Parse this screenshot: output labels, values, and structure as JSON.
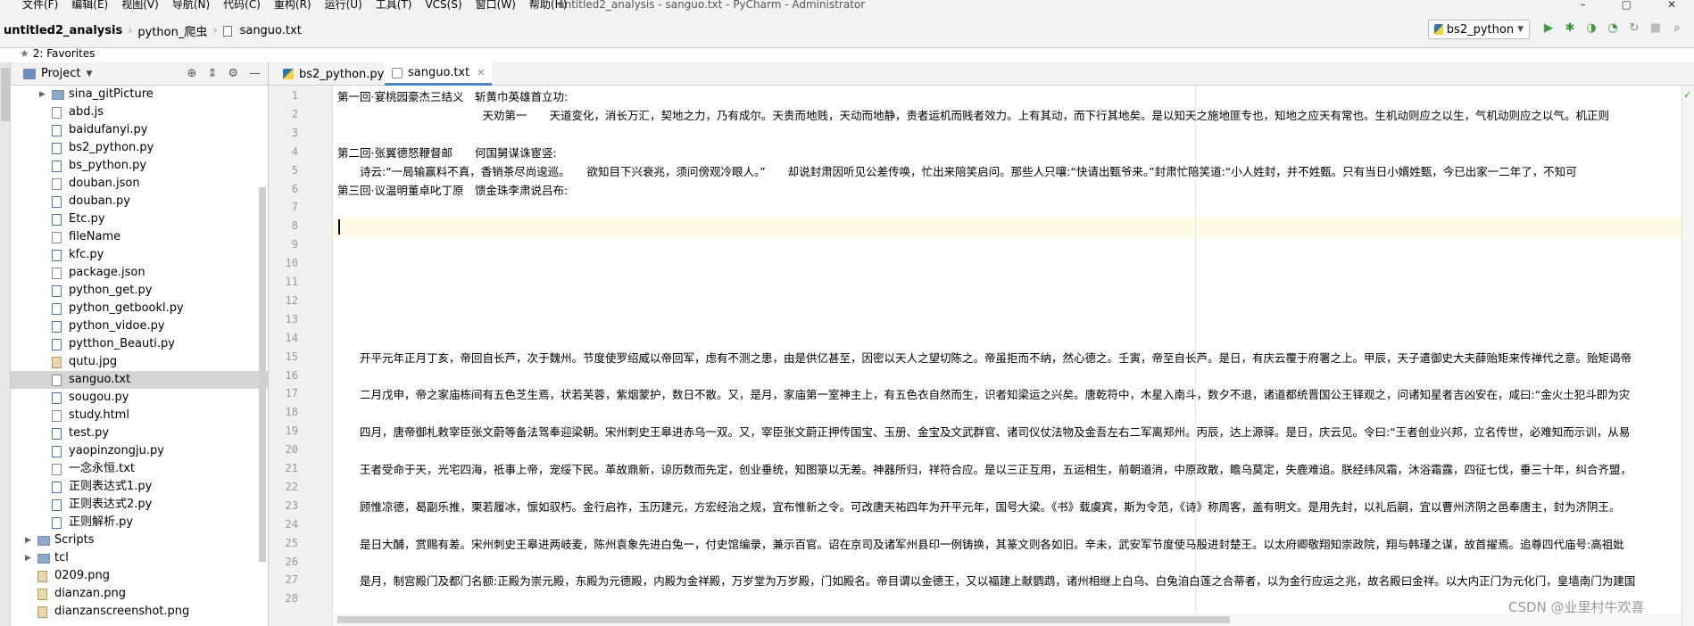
{
  "menubar": {
    "items": [
      "文件(F)",
      "编辑(E)",
      "视图(V)",
      "导航(N)",
      "代码(C)",
      "重构(R)",
      "运行(U)",
      "工具(T)",
      "VCS(S)",
      "窗口(W)",
      "帮助(H)"
    ],
    "window_title": "untitled2_analysis - sanguo.txt - PyCharm - Administrator"
  },
  "navbar": {
    "project": "untitled2_analysis",
    "folder": "python_爬虫",
    "file": "sanguo.txt",
    "run_config": "bs2_python"
  },
  "favorites": {
    "label": "2: Favorites"
  },
  "project_panel": {
    "title": "Project",
    "items": [
      {
        "name": "sina_gitPicture",
        "kind": "folder",
        "expand": true
      },
      {
        "name": "abd.js",
        "kind": "file"
      },
      {
        "name": "baidufanyi.py",
        "kind": "py"
      },
      {
        "name": "bs2_python.py",
        "kind": "py"
      },
      {
        "name": "bs_python.py",
        "kind": "py"
      },
      {
        "name": "douban.json",
        "kind": "file"
      },
      {
        "name": "douban.py",
        "kind": "py"
      },
      {
        "name": "Etc.py",
        "kind": "py"
      },
      {
        "name": "fileName",
        "kind": "file"
      },
      {
        "name": "kfc.py",
        "kind": "py"
      },
      {
        "name": "package.json",
        "kind": "file"
      },
      {
        "name": "python_get.py",
        "kind": "py"
      },
      {
        "name": "python_getbookl.py",
        "kind": "py"
      },
      {
        "name": "python_vidoe.py",
        "kind": "py"
      },
      {
        "name": "pytthon_Beauti.py",
        "kind": "py"
      },
      {
        "name": "qutu.jpg",
        "kind": "img"
      },
      {
        "name": "sanguo.txt",
        "kind": "file",
        "selected": true
      },
      {
        "name": "sougou.py",
        "kind": "py"
      },
      {
        "name": "study.html",
        "kind": "file"
      },
      {
        "name": "test.py",
        "kind": "py"
      },
      {
        "name": "yaopinzongju.py",
        "kind": "py"
      },
      {
        "name": "一念永恒.txt",
        "kind": "file"
      },
      {
        "name": "正则表达式1.py",
        "kind": "py"
      },
      {
        "name": "正则表达式2.py",
        "kind": "py"
      },
      {
        "name": "正则解析.py",
        "kind": "py"
      },
      {
        "name": "Scripts",
        "kind": "folder",
        "expand": true,
        "level": 0
      },
      {
        "name": "tcl",
        "kind": "folder",
        "expand": true,
        "level": 0
      },
      {
        "name": "0209.png",
        "kind": "img",
        "level": 0
      },
      {
        "name": "dianzan.png",
        "kind": "img",
        "level": 0
      },
      {
        "name": "dianzanscreenshot.png",
        "kind": "img",
        "level": 0
      }
    ]
  },
  "tabs": [
    {
      "label": "bs2_python.py",
      "active": false
    },
    {
      "label": "sanguo.txt",
      "active": true
    }
  ],
  "editor": {
    "line_numbers": [
      "1",
      "2",
      "3",
      "4",
      "5",
      "6",
      "7",
      "8",
      "9",
      "10",
      "11",
      "12",
      "13",
      "14",
      "15",
      "16",
      "17",
      "18",
      "19",
      "20",
      "21",
      "22",
      "23",
      "24",
      "25",
      "26",
      "27",
      "28"
    ],
    "lines": [
      "第一回·宴桃园豪杰三结义　斩黄巾英雄首立功:",
      "　　　　　　　　　　　　　天劝第一　　天道变化，消长万汇，契地之力，乃有成尔。天贵而地贱，天动而地静，贵者运机而贱者效力。上有其动，而下行其地矣。是以知天之施地匪专也，知地之应天有常也。生机动则应之以生，气机动则应之以气。机正则",
      "",
      "第二回·张翼德怒鞭督邮　　何国舅谋诛宦竖:",
      "　　诗云:“一局输赢料不真，香销茶尽尚逡巡。　　欲知目下兴衰兆，须问傍观冷眼人。”　　却说封肃因听见公差传唤，忙出来陪笑启问。那些人只嚷:“快请出甄爷来。”封肃忙陪笑道:“小人姓封，并不姓甄。只有当日小婿姓甄，今已出家一二年了，不知可",
      "第三回·议温明董卓叱丁原　馈金珠李肃说吕布:",
      "",
      "",
      "",
      "",
      "",
      "",
      "",
      "",
      "　　开平元年正月丁亥，帝回自长芦，次于魏州。节度使罗绍威以帝回军，虑有不测之患，由是供亿甚至，因密以天人之望切陈之。帝虽拒而不纳，然心德之。壬寅，帝至自长芦。是日，有庆云覆于府署之上。甲辰，天子遣御史大夫薛贻矩来传禅代之意。贻矩谒帝",
      "",
      "　　二月戊申，帝之家庙栋间有五色芝生焉，状若芙蓉，紫烟蒙护，数日不散。又，是月，家庙第一室神主上，有五色衣自然而生，识者知梁运之兴矣。唐乾符中，木星入南斗，数夕不退，诸道都统晋国公王铎观之，问诸知星者吉凶安在，咸曰:“金火土犯斗即为灾",
      "",
      "　　四月，唐帝御札敕宰臣张文蔚等备法驾奉迎梁朝。宋州刺史王皋进赤乌一双。又，宰臣张文蔚正押传国宝、玉册、金宝及文武群官、诸司仪仗法物及金吾左右二军离郑州。丙辰，达上源驿。是日，庆云见。令曰:“王者创业兴邦，立名传世，必难知而示训，从易",
      "",
      "　　王者受命于天，光宅四海，祗事上帝，宠绥下民。革故鼎新，谅历数而先定，创业垂统，知图箓以无差。神器所归，祥符合应。是以三正互用，五运相生，前朝道消，中原政散，瞻乌莫定，失鹿难追。朕经纬风霜，沐浴霜露，四征七伐，垂三十年，纠合齐盟，",
      "",
      "　　顾惟凉德，曷副乐推，栗若履冰，懔如驭朽。金行启祚，玉历建元，方宏经治之规，宜布惟新之令。可改唐天祐四年为开平元年，国号大梁。《书》载虞宾，斯为令范，《诗》称周客，盖有明文。是用先封，以礼后嗣，宜以曹州济阴之邑奉唐主，封为济阴王。",
      "",
      "　　是日大酺，赏赐有差。宋州刺史王皋进两岐麦，陈州袁象先进白兔一，付史馆编录，兼示百官。诏在京司及诸军州县印一例铸换，其篆文则各如旧。辛未，武安军节度使马殷进封楚王。以太府卿敬翔知崇政院，翔与韩瑾之谋，故首擢焉。追尊四代庙号:高祖妣",
      "",
      "　　是月，制宫殿门及都门名额:正殿为崇元殿，东殿为元德殿，内殿为金祥殿，万岁堂为万岁殿，门如殿名。帝目谓以金德王，又以福建上献鹦鹉，诸州相继上白乌、白兔洎白莲之合蒂者，以为金行应运之兆，故名殿曰金祥。以大内正门为元化门，皇墙南门为建国",
      ""
    ]
  },
  "watermark": "CSDN @业里村牛欢喜"
}
